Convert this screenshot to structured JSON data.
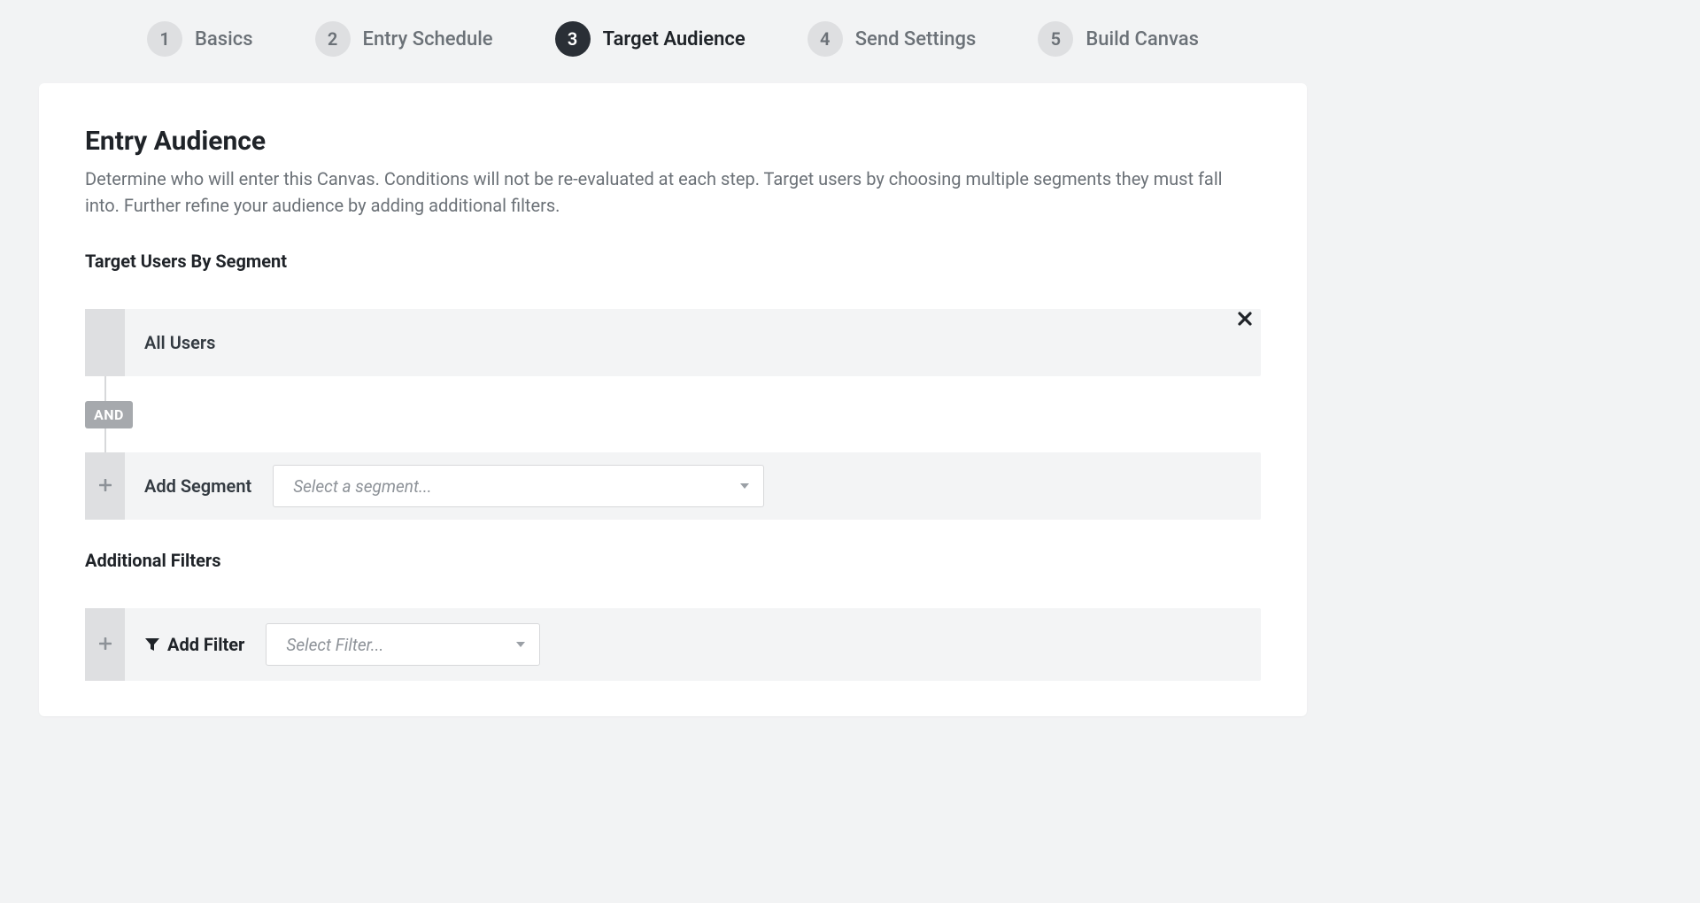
{
  "stepper": {
    "steps": [
      {
        "num": "1",
        "label": "Basics"
      },
      {
        "num": "2",
        "label": "Entry Schedule"
      },
      {
        "num": "3",
        "label": "Target Audience"
      },
      {
        "num": "4",
        "label": "Send Settings"
      },
      {
        "num": "5",
        "label": "Build Canvas"
      }
    ],
    "active_index": 2
  },
  "page": {
    "title": "Entry Audience",
    "description": "Determine who will enter this Canvas. Conditions will not be re-evaluated at each step. Target users by choosing multiple segments they must fall into. Further refine your audience by adding additional filters."
  },
  "segments": {
    "heading": "Target Users By Segment",
    "join_operator": "AND",
    "selected": {
      "name": "All Users"
    },
    "add_label": "Add Segment",
    "select_placeholder": "Select a segment..."
  },
  "filters": {
    "heading": "Additional Filters",
    "add_label": "Add Filter",
    "select_placeholder": "Select Filter..."
  }
}
